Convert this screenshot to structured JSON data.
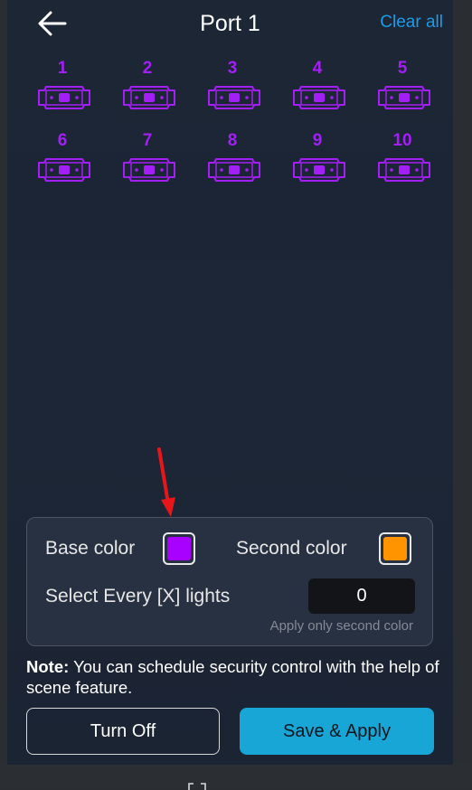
{
  "header": {
    "back_icon": "arrow-left-icon",
    "title": "Port 1",
    "clear_all": "Clear all"
  },
  "lights": [
    {
      "label": "1"
    },
    {
      "label": "2"
    },
    {
      "label": "3"
    },
    {
      "label": "4"
    },
    {
      "label": "5"
    },
    {
      "label": "6"
    },
    {
      "label": "7"
    },
    {
      "label": "8"
    },
    {
      "label": "9"
    },
    {
      "label": "10"
    }
  ],
  "light_color": "#a41ff5",
  "color_panel": {
    "base_color_label": "Base color",
    "base_color_value": "#a901ff",
    "second_color_label": "Second color",
    "second_color_value": "#ff9400",
    "select_every_label": "Select Every [X] lights",
    "select_every_value": "0",
    "hint": "Apply only second color"
  },
  "note": {
    "bold": "Note:",
    "text": " You can schedule security control with the help of scene feature."
  },
  "actions": {
    "turn_off": "Turn Off",
    "save_apply": "Save & Apply"
  },
  "annotation": {
    "arrow_color": "#e8151b"
  }
}
